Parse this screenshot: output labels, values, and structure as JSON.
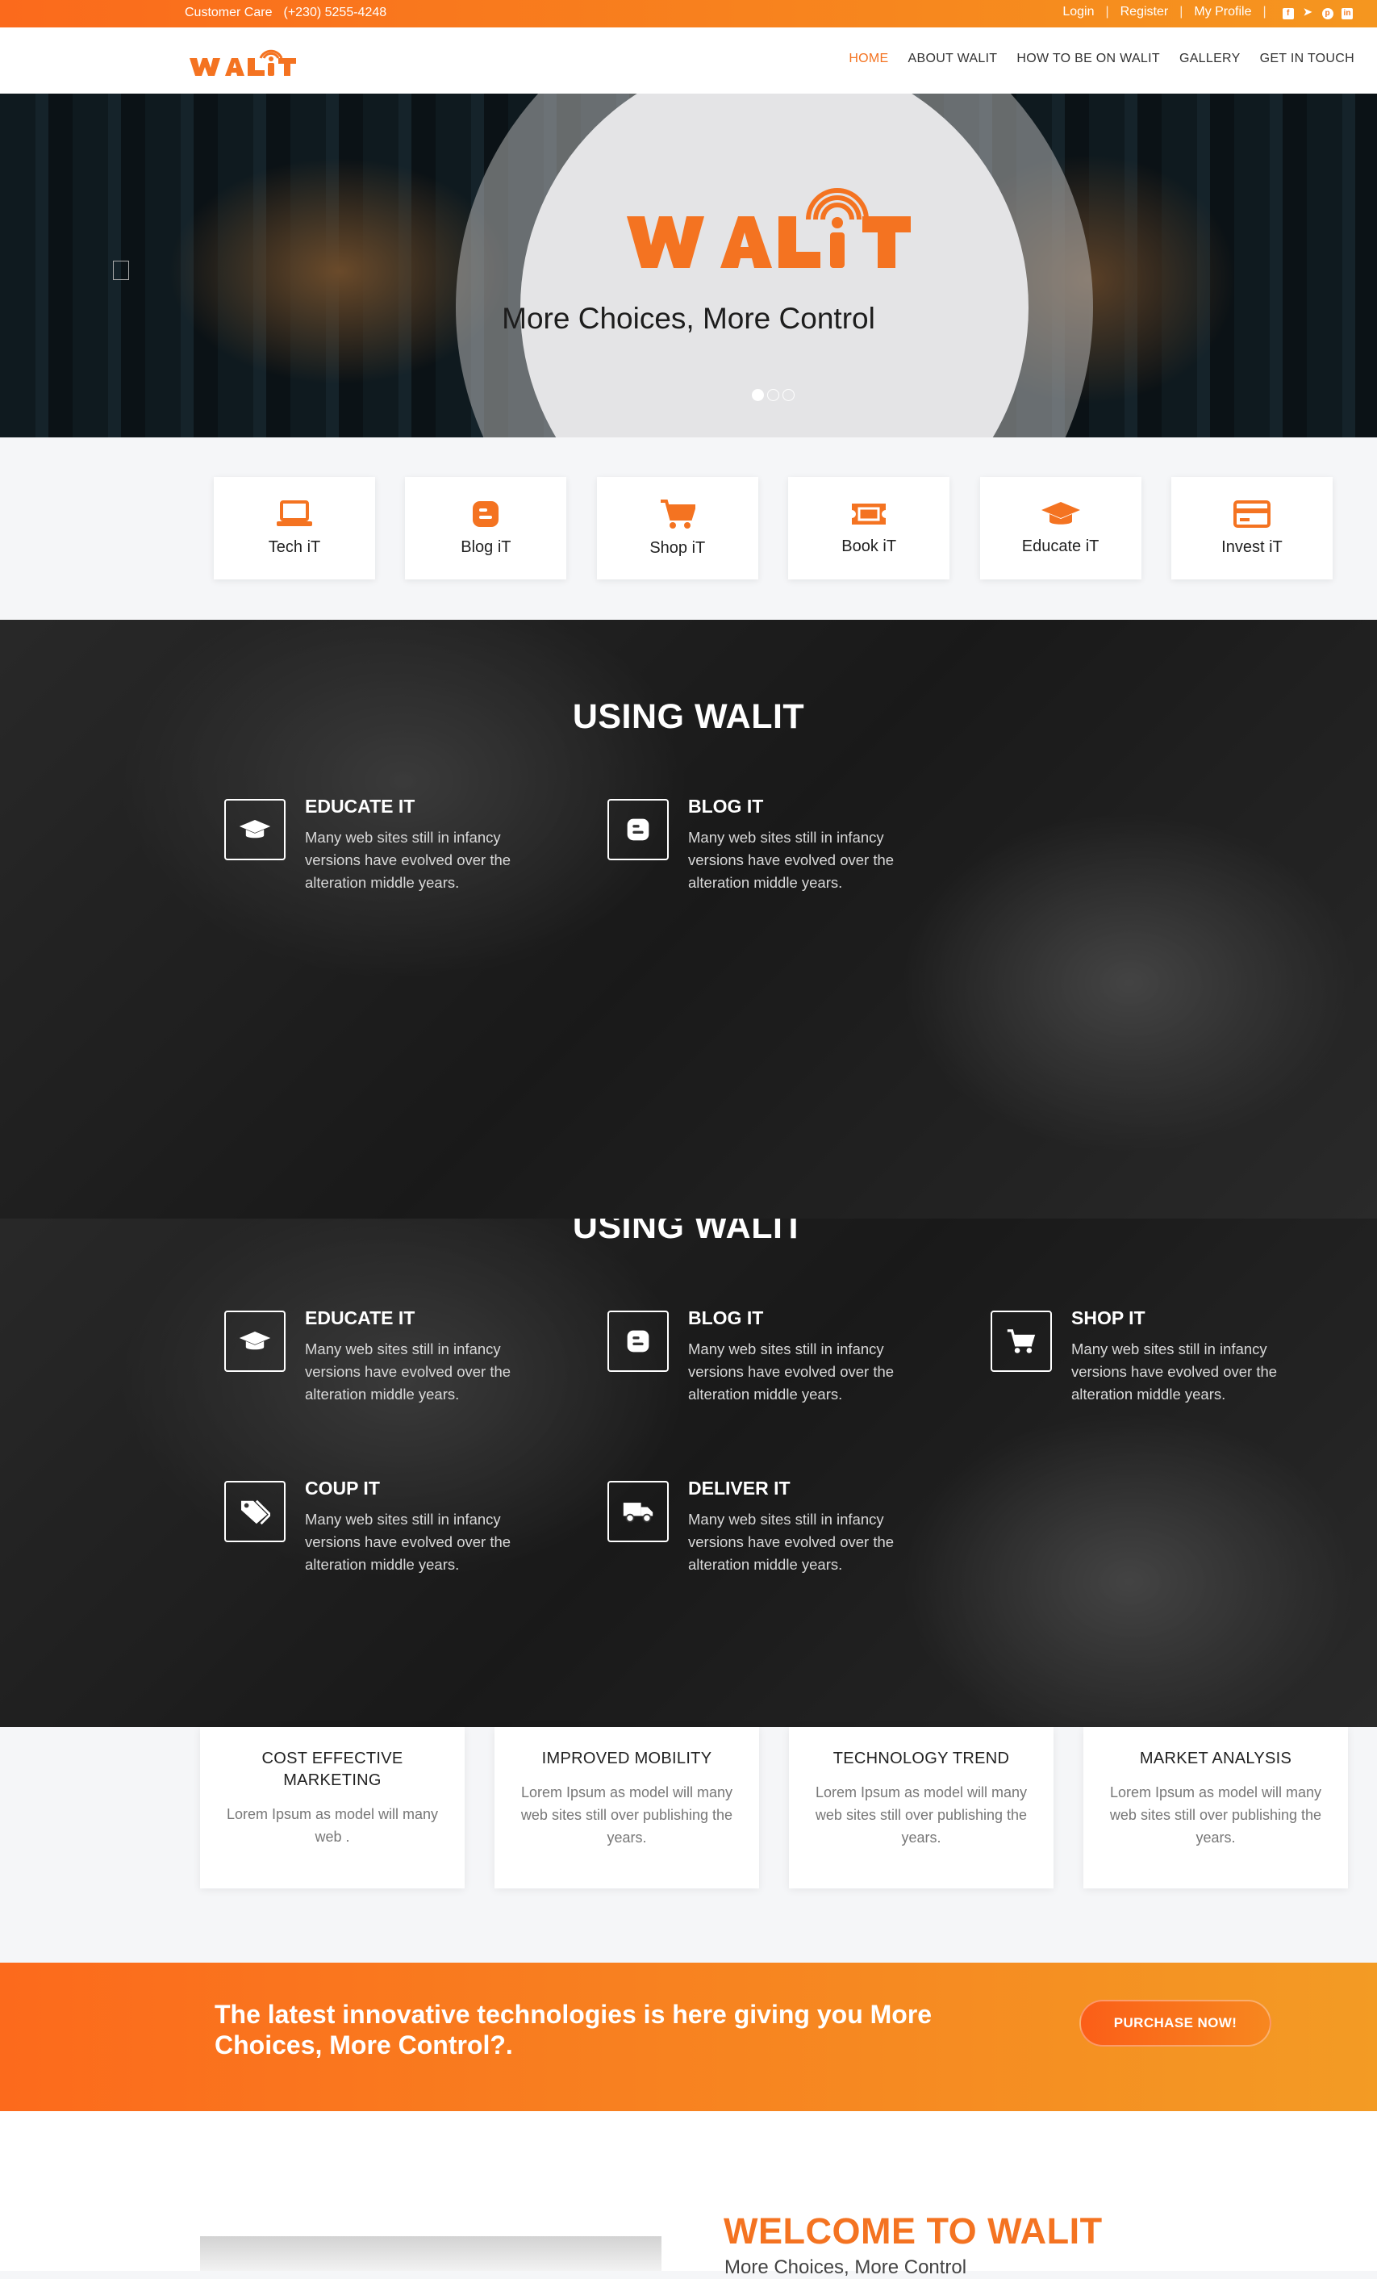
{
  "topbar": {
    "care_label": "Customer Care",
    "phone": "(+230) 5255-4248",
    "login": "Login",
    "register": "Register",
    "profile": "My Profile",
    "sep": "|",
    "social_icons": [
      "facebook-icon",
      "twitter-icon",
      "pinterest-icon",
      "linkedin-icon"
    ]
  },
  "brand": {
    "name": "WALIT",
    "accent": "#f47321"
  },
  "menu": {
    "home": "HOME",
    "about": "ABOUT WALIT",
    "how": "HOW TO BE ON WALIT",
    "gallery": "GALLERY",
    "contact": "GET IN TOUCH"
  },
  "hero": {
    "tagline": "More Choices, More Control",
    "slides": 3,
    "active_slide": 1
  },
  "categories": [
    {
      "label": "Tech iT",
      "icon": "laptop-icon"
    },
    {
      "label": "Blog iT",
      "icon": "blogger-icon"
    },
    {
      "label": "Shop iT",
      "icon": "cart-icon"
    },
    {
      "label": "Book iT",
      "icon": "ticket-icon"
    },
    {
      "label": "Educate iT",
      "icon": "graduation-cap-icon"
    },
    {
      "label": "Invest iT",
      "icon": "credit-card-icon"
    }
  ],
  "using": {
    "title": "USING WALIT",
    "desc": "Many web sites still in infancy versions have evolved over the alteration middle years.",
    "educate": "EDUCATE IT",
    "blog": "BLOG IT",
    "shop": "SHOP IT",
    "coup": "COUP IT",
    "deliver": "DELIVER IT"
  },
  "cards": [
    {
      "title": "COST EFFECTIVE MARKETING",
      "text": "Lorem Ipsum as model will many web ."
    },
    {
      "title": "IMPROVED MOBILITY",
      "text": "Lorem Ipsum as model will many web sites still over publishing the years."
    },
    {
      "title": "TECHNOLOGY TREND",
      "text": "Lorem Ipsum as model will many web sites still over publishing the years."
    },
    {
      "title": "MARKET ANALYSIS",
      "text": "Lorem Ipsum as model will many web sites still over publishing the years."
    }
  ],
  "cta": {
    "text": "The latest innovative technologies is here giving you More Choices, More Control?.",
    "button": "PURCHASE NOW!"
  },
  "welcome": {
    "title": "WELCOME TO WALIT",
    "subtitle": "More Choices, More Control"
  }
}
